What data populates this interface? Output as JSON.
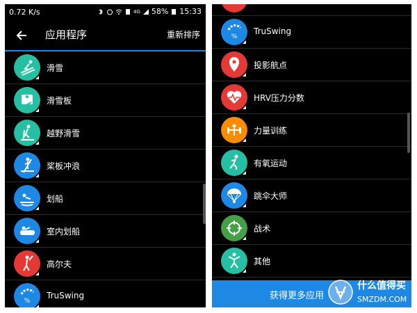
{
  "status_bar": {
    "speed": "0.72 K/s",
    "network": "4G",
    "battery": "58%",
    "time": "15:33"
  },
  "app_bar": {
    "title": "应用程序",
    "action_label": "重新排序"
  },
  "left_list": [
    {
      "label": "滑雪",
      "icon": "skiing-icon",
      "color": "#26bfa4"
    },
    {
      "label": "滑雪板",
      "icon": "snowboard-icon",
      "color": "#26bfa4"
    },
    {
      "label": "越野滑雪",
      "icon": "xc-ski-icon",
      "color": "#26bfa4"
    },
    {
      "label": "桨板冲浪",
      "icon": "sup-icon",
      "color": "#1e88e5"
    },
    {
      "label": "划船",
      "icon": "rowing-icon",
      "color": "#1e88e5"
    },
    {
      "label": "室内划船",
      "icon": "indoor-rowing-icon",
      "color": "#1e88e5"
    },
    {
      "label": "高尔夫",
      "icon": "golf-icon",
      "color": "#e53935"
    },
    {
      "label": "TruSwing",
      "icon": "truswing-icon",
      "color": "#1e88e5"
    }
  ],
  "right_list": [
    {
      "label": "TruSwing",
      "icon": "truswing-icon",
      "color": "#1e88e5"
    },
    {
      "label": "投影航点",
      "icon": "waypoint-icon",
      "color": "#e53935"
    },
    {
      "label": "HRV压力分数",
      "icon": "heart-icon",
      "color": "#e53935"
    },
    {
      "label": "力量训练",
      "icon": "strength-icon",
      "color": "#fb8c00"
    },
    {
      "label": "有氧运动",
      "icon": "cardio-icon",
      "color": "#26bfa4"
    },
    {
      "label": "跳伞大师",
      "icon": "jumpmaster-icon",
      "color": "#1e88e5"
    },
    {
      "label": "战术",
      "icon": "tactical-icon",
      "color": "#43a047"
    },
    {
      "label": "其他",
      "icon": "other-icon",
      "color": "#26bfa4"
    }
  ],
  "bottom_button": {
    "label": "获得更多应用"
  },
  "watermark": {
    "line1": "什么值得买",
    "line2": "SMZDM.COM"
  }
}
